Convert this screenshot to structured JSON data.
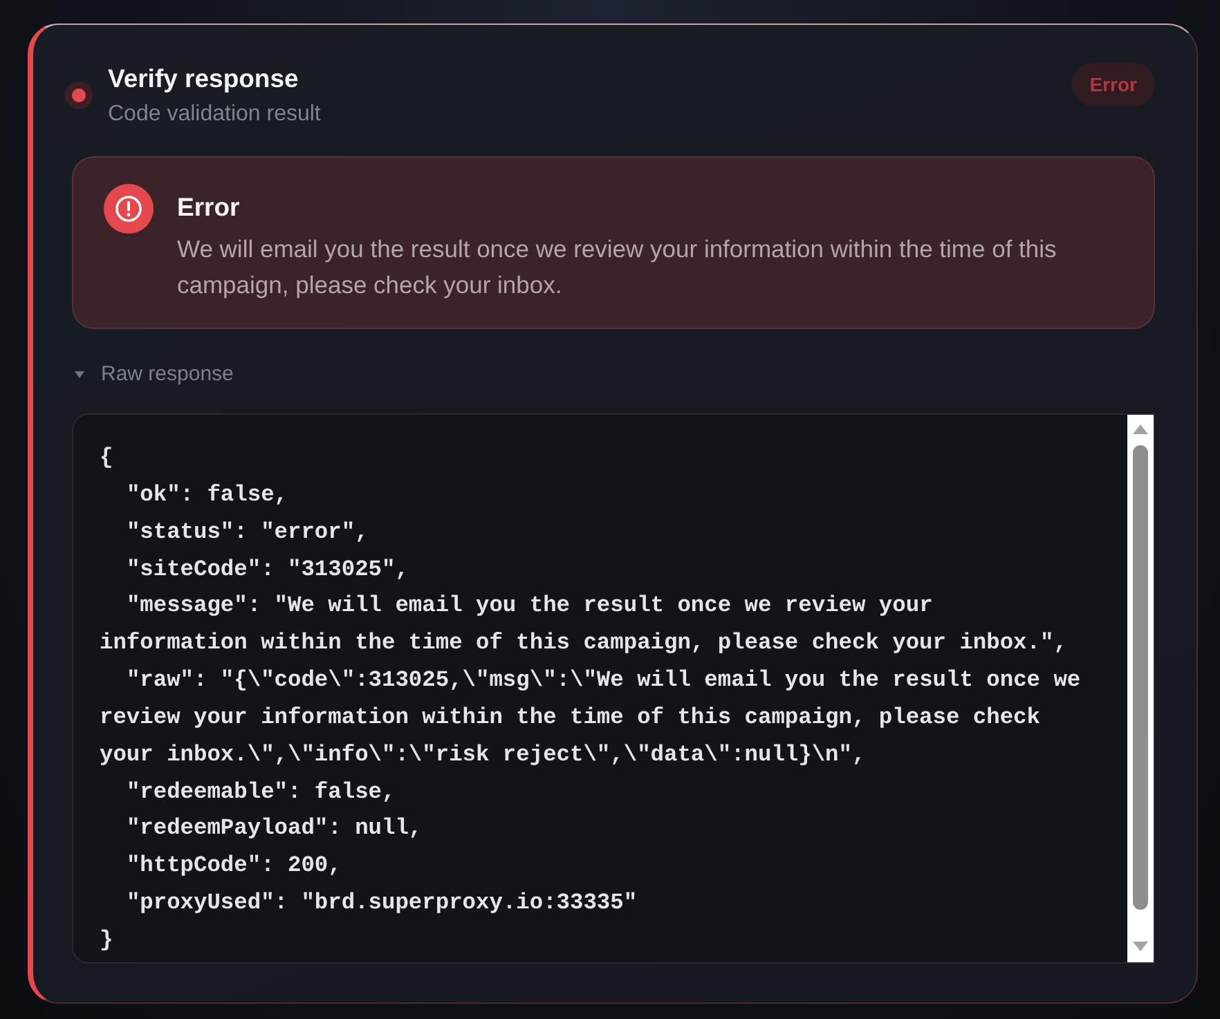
{
  "card": {
    "kind": "error",
    "title": "Verify response",
    "subtitle": "Code validation result",
    "badge": "Error"
  },
  "alert": {
    "kind": "error",
    "title": "Error",
    "message": "We will email you the result once we review your information within the time of this campaign, please check your inbox."
  },
  "raw_response": {
    "label": "Raw response",
    "expanded": true,
    "lines": [
      "{",
      "  \"ok\": false,",
      "  \"status\": \"error\",",
      "  \"siteCode\": \"313025\",",
      "  \"message\": \"We will email you the result once we review your information within the time of this campaign, please check your inbox.\",",
      "  \"raw\": \"{\\\"code\\\":313025,\\\"msg\\\":\\\"We will email you the result once we review your information within the time of this campaign, please check your inbox.\\\",\\\"info\\\":\\\"risk reject\\\",\\\"data\\\":null}\\n\",",
      "  \"redeemable\": false,",
      "  \"redeemPayload\": null,",
      "  \"httpCode\": 200,",
      "  \"proxyUsed\": \"brd.superproxy.io:33335\"",
      "}"
    ]
  }
}
